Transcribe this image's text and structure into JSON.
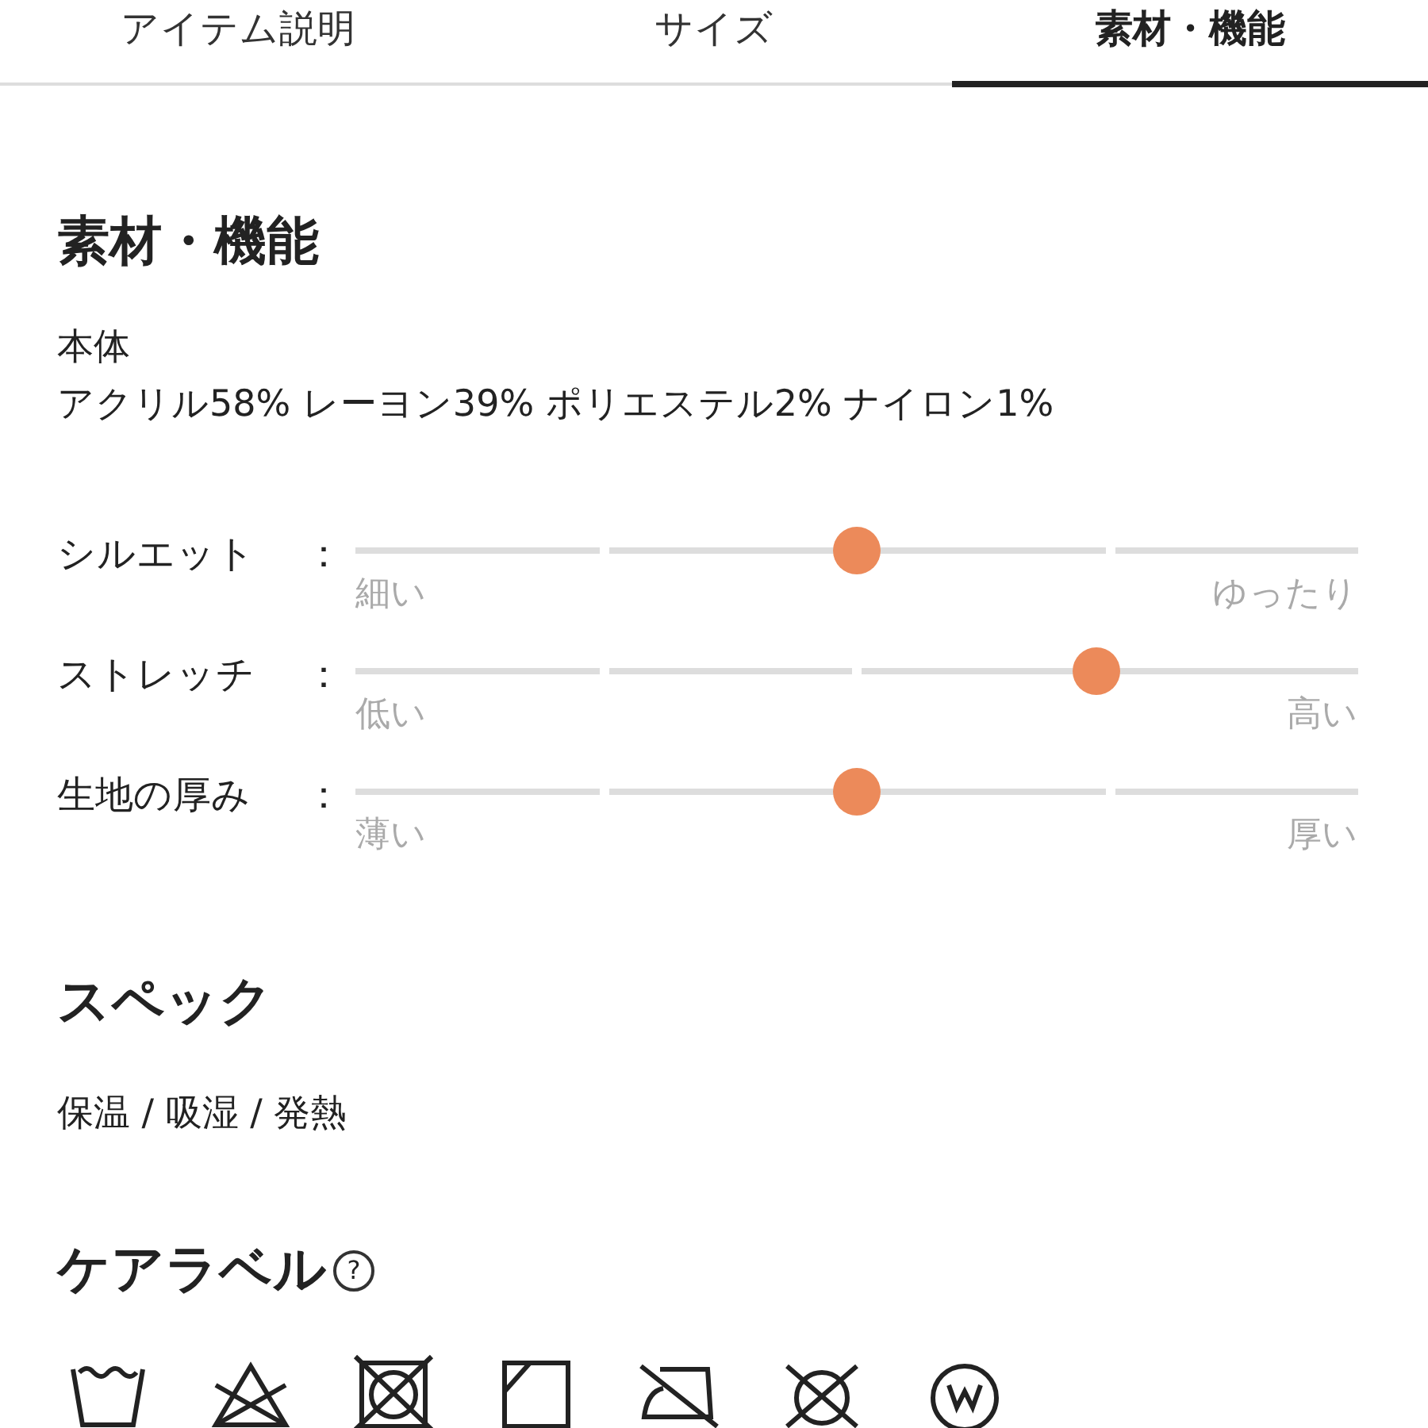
{
  "tabs": [
    {
      "label": "アイテム説明",
      "selected": false
    },
    {
      "label": "サイズ",
      "selected": false
    },
    {
      "label": "素材・機能",
      "selected": true
    }
  ],
  "material": {
    "heading": "素材・機能",
    "part": "本体",
    "composition": "アクリル58% レーヨン39% ポリエステル2% ナイロン1%"
  },
  "sliders": [
    {
      "label": "シルエット",
      "separator": "：",
      "level": 0.5,
      "min_label": "細い",
      "max_label": "ゆったり"
    },
    {
      "label": "ストレッチ",
      "separator": "：",
      "level": 0.75,
      "min_label": "低い",
      "max_label": "高い"
    },
    {
      "label": "生地の厚み",
      "separator": "：",
      "level": 0.5,
      "min_label": "薄い",
      "max_label": "厚い"
    }
  ],
  "spec": {
    "heading": "スペック",
    "text": "保温 / 吸湿 / 発熱"
  },
  "care": {
    "heading": "ケアラベル",
    "help": "?"
  }
}
